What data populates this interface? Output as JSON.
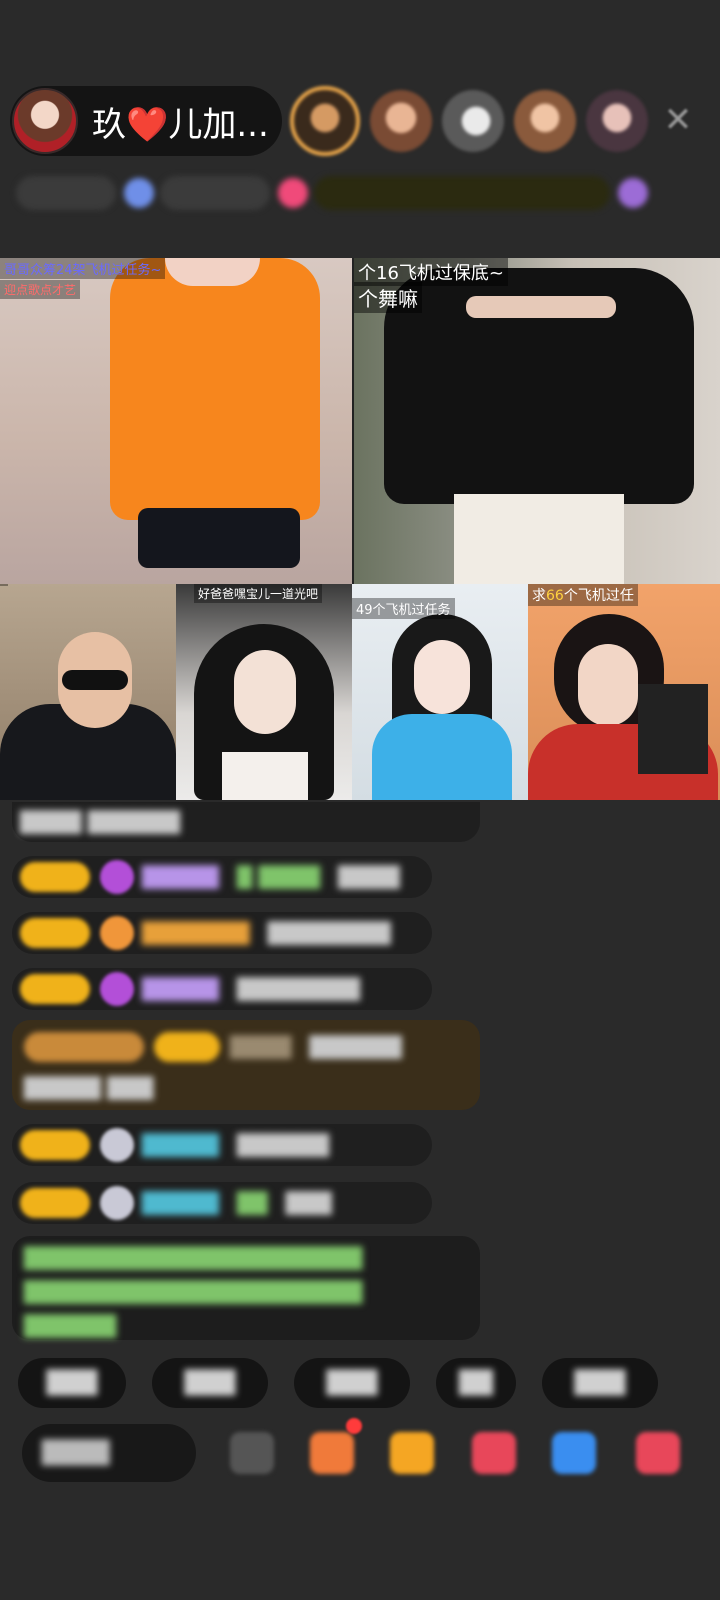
{
  "header": {
    "host_name": "玖❤️儿加...",
    "viewer_count": 5,
    "close_label": "✕"
  },
  "grid": {
    "tiles": [
      {
        "caption1": "哥哥众筹24架飞机过任务~",
        "caption2": "迎点歌点才艺"
      },
      {
        "caption1": "个16飞机过保底~",
        "caption2": "个舞嘛"
      },
      {
        "caption1": ""
      },
      {
        "caption1": "好爸爸嘿宝儿一道光吧"
      },
      {
        "caption1": "49个飞机过任务"
      },
      {
        "caption1_prefix": "求",
        "caption1_num": "66",
        "caption1_suffix": "个飞机过任"
      }
    ]
  },
  "colors": {
    "background": "#2a2a2a",
    "badge_gold": "#f0b21a",
    "accent_red": "#e2232a"
  }
}
